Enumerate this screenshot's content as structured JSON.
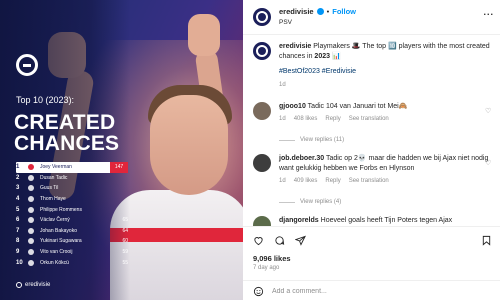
{
  "graphic": {
    "subtitle": "Top 10 (2023):",
    "headline_line1": "CREATED",
    "headline_line2": "CHANCES",
    "ranking": [
      {
        "rank": "1",
        "name": "Joey Veerman",
        "value": "147"
      },
      {
        "rank": "2",
        "name": "Dusan Tadic",
        "value": ""
      },
      {
        "rank": "3",
        "name": "Guus Til",
        "value": ""
      },
      {
        "rank": "4",
        "name": "Thom Haye",
        "value": ""
      },
      {
        "rank": "5",
        "name": "Philippe Rommens",
        "value": ""
      },
      {
        "rank": "6",
        "name": "Václav Černý",
        "value": "65"
      },
      {
        "rank": "7",
        "name": "Johan Bakayoko",
        "value": "64"
      },
      {
        "rank": "8",
        "name": "Yukinari Sugawara",
        "value": "60"
      },
      {
        "rank": "9",
        "name": "Vito van Crooij",
        "value": "59"
      },
      {
        "rank": "10",
        "name": "Orkun Kökcü",
        "value": "55"
      }
    ],
    "footer_brand": "eredivisie",
    "colors": {
      "accent_red": "#e0263b",
      "navy": "#1b1f5a"
    }
  },
  "header": {
    "account": "eredivisie",
    "follow_label": "Follow",
    "location": "PSV",
    "more_label": "..."
  },
  "caption": {
    "account": "eredivisie",
    "text_a": "Playmakers 🎩 The top 🔟 players with the most created chances in",
    "year": "2023",
    "text_b": "📊",
    "hashtags": "#BestOf2023 #Eredivisie",
    "time": "1d"
  },
  "comments": [
    {
      "user": "gjooo10",
      "text": "Tadic 104 van Januari tot Mei🙈",
      "time": "1d",
      "likes": "408 likes",
      "reply": "Reply",
      "translation": "See translation",
      "view_replies": "View replies (11)",
      "avatar_color": "#7a6a5c"
    },
    {
      "user": "job.deboer.30",
      "text": "Tadic op 2💀 maar die hadden we bij Ajax niet nodig want gelukkig hebben we Forbs en Hlynson",
      "time": "1d",
      "likes": "409 likes",
      "reply": "Reply",
      "translation": "See translation",
      "view_replies": "View replies (4)",
      "avatar_color": "#3d3d3d"
    },
    {
      "user": "djangorelds",
      "text": "Hoeveel goals heeft Tijn Poters tegen Ajax",
      "avatar_color": "#5b6b4a"
    }
  ],
  "stats": {
    "likes": "9,096 likes",
    "ago": "7 day ago"
  },
  "add_comment": {
    "placeholder": "Add a comment..."
  },
  "icons": {
    "like": "heart-icon",
    "comment": "comment-icon",
    "share": "share-icon",
    "save": "bookmark-icon",
    "emoji": "emoji-icon"
  }
}
